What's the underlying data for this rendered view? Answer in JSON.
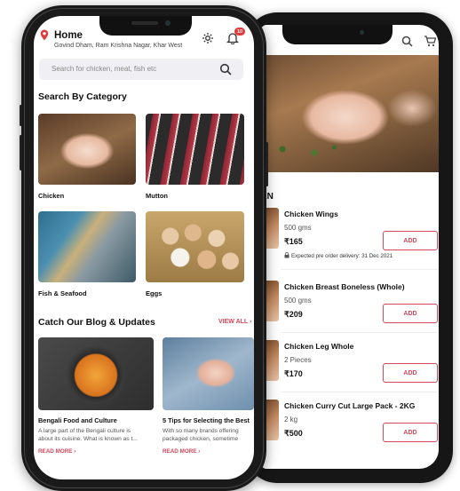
{
  "home": {
    "title": "Home",
    "address": "Govind Dham, Ram Krishna Nagar, Khar West",
    "notification_count": "10",
    "search_placeholder": "Search for chicken, meat, fish etc"
  },
  "categories": {
    "title": "Search By Category",
    "items": [
      {
        "label": "Chicken"
      },
      {
        "label": "Mutton"
      },
      {
        "label": "Fish & Seafood"
      },
      {
        "label": "Eggs"
      }
    ]
  },
  "blog": {
    "title": "Catch Our Blog & Updates",
    "view_all": "VIEW ALL",
    "posts": [
      {
        "title": "Bengali Food and Culture",
        "desc_line1": "A large part of the Bengali culture is",
        "desc_line2": "about its cuisine. What is known as t...",
        "read_more": "READ MORE"
      },
      {
        "title": "5 Tips for Selecting the Best",
        "desc_line1": "With so many brands offering",
        "desc_line2": "packaged chicken, sometime",
        "read_more": "READ MORE"
      }
    ]
  },
  "product_list": {
    "section_title": "EN",
    "add_label": "ADD",
    "products": [
      {
        "name": "Chicken Wings",
        "qty": "500 gms",
        "price": "₹165",
        "delivery": "Expected pre order delivery: 31 Dec 2021"
      },
      {
        "name": "Chicken Breast Boneless (Whole)",
        "qty": "500 gms",
        "price": "₹209",
        "delivery": ""
      },
      {
        "name": "Chicken Leg Whole",
        "qty": "2 Pieces",
        "price": "₹170",
        "delivery": ""
      },
      {
        "name": "Chicken Curry Cut Large Pack - 2KG",
        "qty": "2 kg",
        "price": "₹500",
        "delivery": ""
      }
    ]
  },
  "colors": {
    "accent": "#d4465a",
    "location_pin": "#e03a3a"
  },
  "icons": [
    "location-pin-icon",
    "settings-icon",
    "bell-icon",
    "search-icon",
    "cart-icon",
    "lock-icon",
    "chevron-right-icon"
  ]
}
